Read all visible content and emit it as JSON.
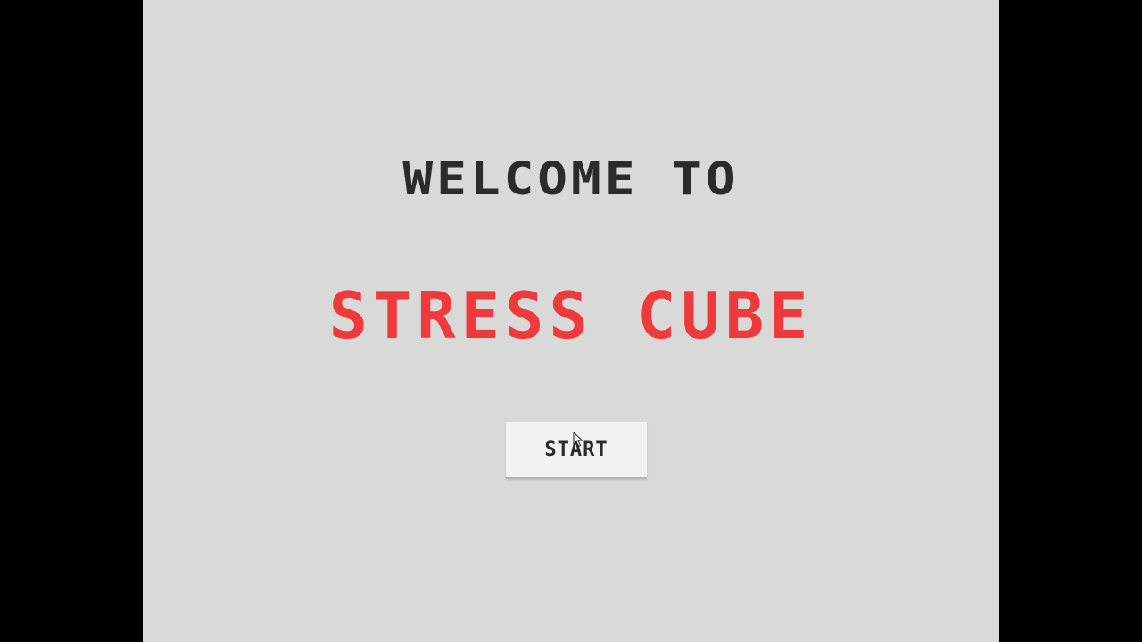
{
  "welcome": {
    "text": "WELCOME TO"
  },
  "title": {
    "text": "STRESS CUBE"
  },
  "start_button": {
    "label": "START"
  },
  "colors": {
    "background": "#d9dad8",
    "letterbox": "#000000",
    "heading": "#2b2b2b",
    "title": "#ef3a3d",
    "button": "#f2f2f2"
  },
  "cursor": {
    "icon": "mouse-pointer-icon"
  }
}
